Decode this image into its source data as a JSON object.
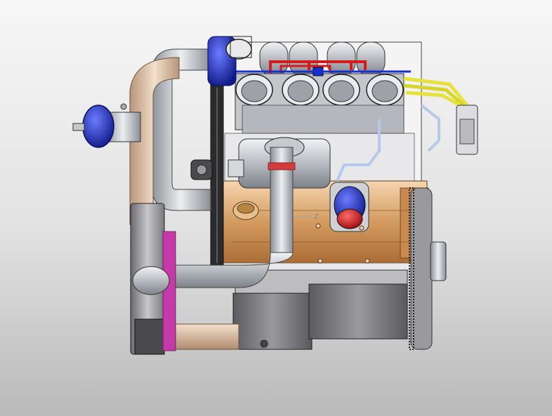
{
  "viewport": {
    "background_top": "#f7f7f7",
    "background_bottom": "#b9b9b9"
  },
  "triad": {
    "z_label": "Z"
  },
  "colors": {
    "block_copper": "#c98f55",
    "steel_gray": "#a9adb3",
    "oil_pan_dark": "#6f6f73",
    "intake_tube_tan": "#d9b79a",
    "blow_off_blue": "#2230b8",
    "filter_red": "#cc1f1f",
    "fuel_rail_red": "#d41a1a",
    "spark_wire_yellow": "#e6e23a",
    "fan_housing_magenta": "#c43aa7"
  }
}
